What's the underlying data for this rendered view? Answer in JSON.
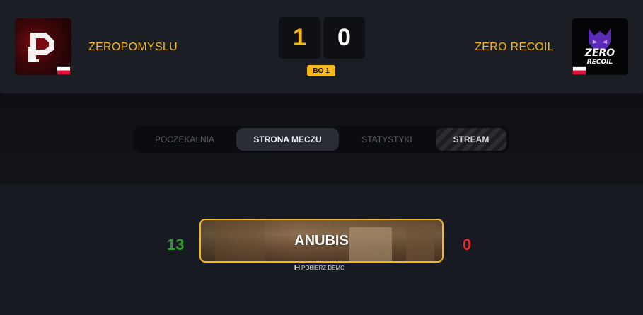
{
  "match": {
    "team_left": {
      "name": "ZEROPOMYSLU",
      "logo_icon": "zeropomyslu-logo",
      "flag": "poland-flag"
    },
    "team_right": {
      "name": "ZERO RECOIL",
      "logo_icon": "zero-recoil-logo",
      "logo_text_1": "ZERO",
      "logo_text_2": "RECOIL",
      "flag": "poland-flag"
    },
    "score_left": "1",
    "score_right": "0",
    "format": "BO 1"
  },
  "tabs": [
    {
      "label": "POCZEKALNIA",
      "active": false
    },
    {
      "label": "STRONA MECZU",
      "active": true
    },
    {
      "label": "STATYSTYKI",
      "active": false
    },
    {
      "label": "STREAM",
      "active": false
    }
  ],
  "map": {
    "name": "ANUBIS",
    "score_left": "13",
    "score_right": "0",
    "demo_label": "POBIERZ DEMO"
  },
  "colors": {
    "accent": "#f5b71b",
    "win": "#2e9b2e",
    "loss": "#e8262b",
    "background": "#15171c"
  }
}
